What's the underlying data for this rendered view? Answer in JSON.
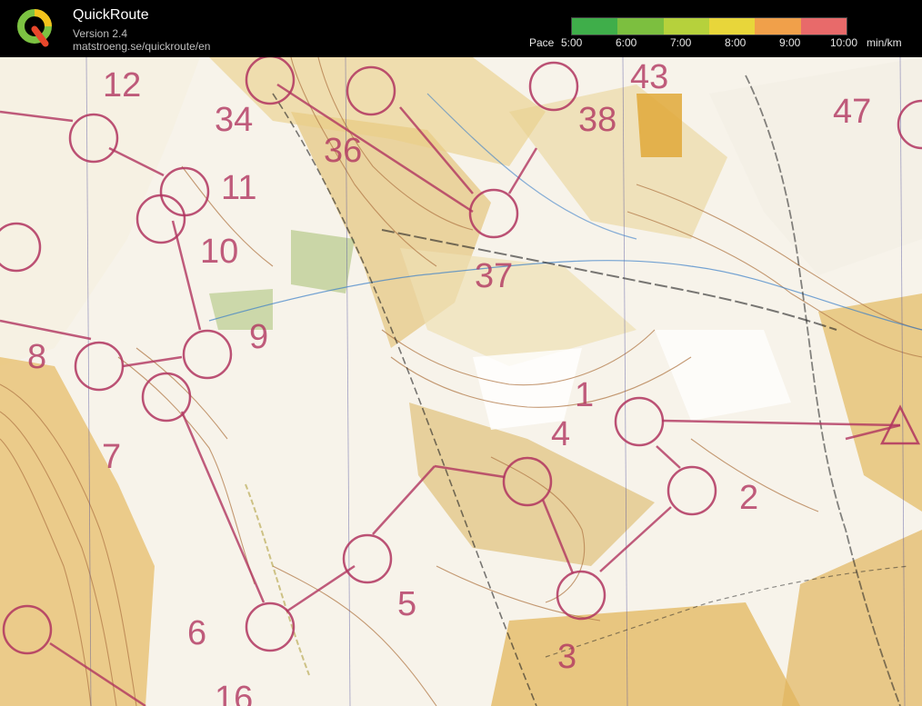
{
  "app": {
    "name": "QuickRoute",
    "version": "Version 2.4",
    "url": "matstroeng.se/quickroute/en"
  },
  "pace": {
    "label": "Pace",
    "ticks": [
      "5:00",
      "6:00",
      "7:00",
      "8:00",
      "9:00",
      "10:00"
    ],
    "unit": "min/km",
    "colors": [
      "#3fae4a",
      "#7cbf3f",
      "#b6d13c",
      "#e8d63a",
      "#f0a04a",
      "#e86a6a"
    ]
  },
  "map": {
    "control_labels": [
      "12",
      "34",
      "36",
      "43",
      "38",
      "47",
      "11",
      "10",
      "37",
      "9",
      "8",
      "1",
      "7",
      "4",
      "2",
      "5",
      "6",
      "3",
      "16"
    ]
  }
}
